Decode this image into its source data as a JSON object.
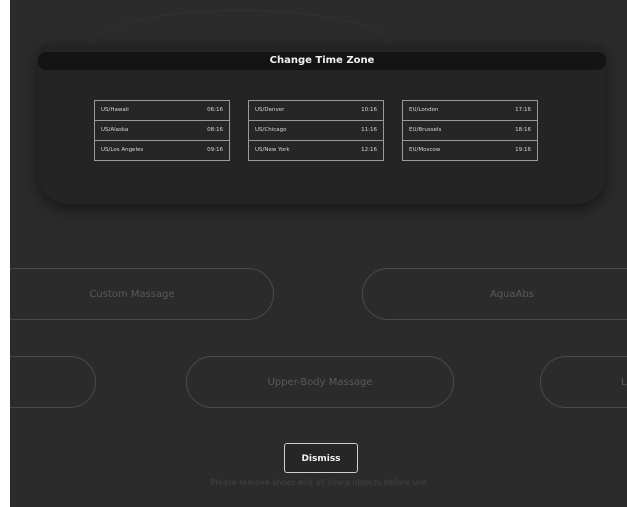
{
  "dialog": {
    "title": "Change Time Zone",
    "columns": [
      [
        {
          "zone": "US/Hawaii",
          "time": "06:16"
        },
        {
          "zone": "US/Alaska",
          "time": "08:16"
        },
        {
          "zone": "US/Los Angeles",
          "time": "09:16"
        }
      ],
      [
        {
          "zone": "US/Denver",
          "time": "10:16"
        },
        {
          "zone": "US/Chicago",
          "time": "11:16"
        },
        {
          "zone": "US/New York",
          "time": "12:16"
        }
      ],
      [
        {
          "zone": "EU/London",
          "time": "17:16"
        },
        {
          "zone": "EU/Brussels",
          "time": "18:16"
        },
        {
          "zone": "EU/Moscow",
          "time": "19:16"
        }
      ]
    ],
    "dismiss_label": "Dismiss"
  },
  "background": {
    "buttons": [
      {
        "label": "Custom Massage"
      },
      {
        "label": "AquaAbs"
      },
      {
        "label": "e"
      },
      {
        "label": "Upper-Body Massage"
      },
      {
        "label": "Lo"
      }
    ],
    "footer_note": "Please remove shoes and all sharp objects before use"
  }
}
